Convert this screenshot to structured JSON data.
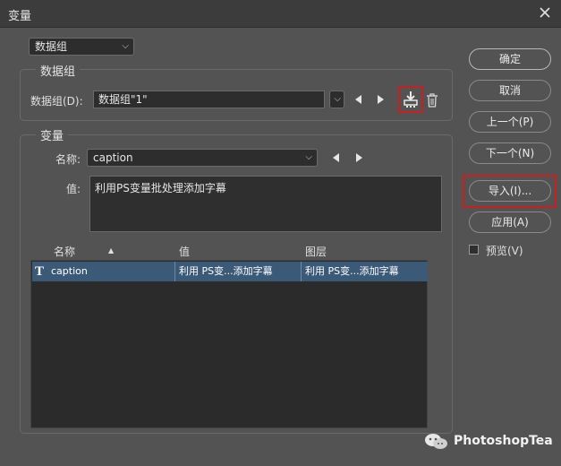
{
  "window": {
    "title": "变量"
  },
  "top_select": {
    "value": "数据组"
  },
  "data_group": {
    "legend": "数据组",
    "label": "数据组(D):",
    "value": "数据组\"1\"",
    "prev_symbol": "◀",
    "next_symbol": "▶",
    "save_icon": "save-data-group-icon",
    "trash_icon": "trash-icon"
  },
  "variable": {
    "legend": "变量",
    "name_label": "名称:",
    "name_value": "caption",
    "value_label": "值:",
    "value_text": "利用PS变量批处理添加字幕"
  },
  "table": {
    "headers": [
      "名称",
      "值",
      "图层"
    ],
    "sort_indicator": "▲",
    "rows": [
      {
        "type_glyph": "T",
        "name": "caption",
        "value": "利用 PS变...添加字幕",
        "layer": "利用 PS变...添加字幕"
      }
    ]
  },
  "buttons": {
    "ok": "确定",
    "cancel": "取消",
    "prev": "上一个(P)",
    "next": "下一个(N)",
    "import": "导入(I)...",
    "apply": "应用(A)"
  },
  "preview": {
    "label": "预览(V)",
    "checked": false
  },
  "watermark": {
    "text": "PhotoshopTea"
  },
  "colors": {
    "highlight": "#c91f1f",
    "selected_row": "#3b5a78"
  }
}
